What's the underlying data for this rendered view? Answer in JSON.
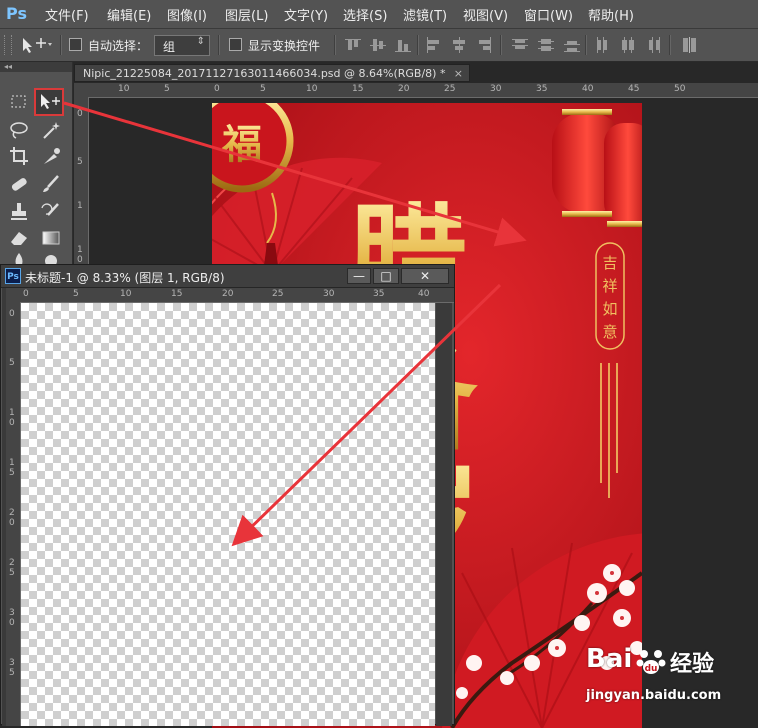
{
  "app": {
    "logo": "Ps"
  },
  "menu": {
    "items": [
      {
        "label": "文件(F)"
      },
      {
        "label": "编辑(E)"
      },
      {
        "label": "图像(I)"
      },
      {
        "label": "图层(L)"
      },
      {
        "label": "文字(Y)"
      },
      {
        "label": "选择(S)"
      },
      {
        "label": "滤镜(T)"
      },
      {
        "label": "视图(V)"
      },
      {
        "label": "窗口(W)"
      },
      {
        "label": "帮助(H)"
      }
    ]
  },
  "options": {
    "auto_select_label": "自动选择：",
    "group_value": "组",
    "show_transform_label": "显示变换控件",
    "auto_select_checked": false,
    "show_transform_checked": false
  },
  "toolbox": {
    "collapse_glyph": "◂◂",
    "highlighted_tool": "move-tool",
    "highlight_color": "#d93a3a"
  },
  "main_doc": {
    "tab_title": "Nipic_21225084_20171127163011466034.psd @ 8.64%(RGB/8) *",
    "tab_close": "×",
    "ruler_h": [
      "10",
      "5",
      "0",
      "5",
      "10",
      "15",
      "20",
      "25",
      "30",
      "35",
      "40",
      "45",
      "50"
    ],
    "ruler_v": [
      "0",
      "5",
      "1",
      "1",
      "0"
    ]
  },
  "poster": {
    "fu": "福",
    "big_chars": [
      "腊",
      "备",
      "岁"
    ],
    "seal_lines": [
      "吉",
      "祥",
      "如",
      "意"
    ],
    "background_color": "#c4141c",
    "gold_color": "#e6b84a"
  },
  "child_doc": {
    "logo": "Ps",
    "title": "未标题-1 @ 8.33% (图层 1, RGB/8)",
    "minimize": "—",
    "maximize": "□",
    "close": "✕",
    "ruler_h": [
      "0",
      "5",
      "10",
      "15",
      "20",
      "25",
      "30",
      "35",
      "40"
    ],
    "ruler_v": [
      {
        "a": "0",
        "b": ""
      },
      {
        "a": "5",
        "b": ""
      },
      {
        "a": "1",
        "b": "0"
      },
      {
        "a": "1",
        "b": "5"
      },
      {
        "a": "2",
        "b": "0"
      },
      {
        "a": "2",
        "b": "5"
      },
      {
        "a": "3",
        "b": "0"
      },
      {
        "a": "3",
        "b": "5"
      }
    ]
  },
  "watermark": {
    "brand": "Bai",
    "brand2": "经验",
    "url": "jingyan.baidu.com"
  },
  "annotation_arrow_color": "#e8343a"
}
